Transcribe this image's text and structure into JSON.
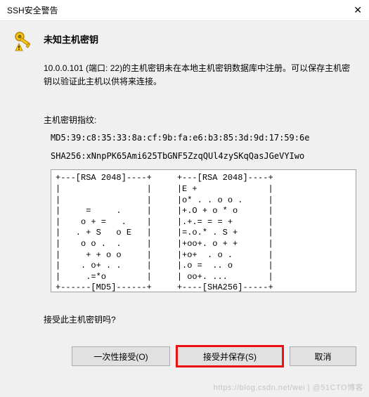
{
  "titlebar": {
    "title": "SSH安全警告"
  },
  "heading": "未知主机密钥",
  "message": "10.0.0.101 (端口: 22)的主机密钥未在本地主机密钥数据库中注册。可以保存主机密钥以验证此主机以供将来连接。",
  "fingerprint_label": "主机密钥指纹:",
  "md5_fingerprint": "MD5:39:c8:35:33:8a:cf:9b:fa:e6:b3:85:3d:9d:17:59:6e",
  "sha256_fingerprint": "SHA256:xNnpPK65Ami625TbGNF5ZzqQUl4zySKqQasJGeVYIwo",
  "ascii_art": "+---[RSA 2048]----+     +---[RSA 2048]----+\n|                 |     |E +              |\n|                 |     |o* . . o o .     |\n|     =     .     |     |+.O + o * o      |\n|    o + =   .    |     |.+.= = = +       |\n|   . + S   o E   |     |=.o.* . S +      |\n|    o o .  .     |     |+oo+. o + +      |\n|     + + o o     |     |+o+  . o .       |\n|    . o+ . .     |     |.o =  .. o       |\n|     .=*o        |     | oo+. ...        |\n+------[MD5]------+     +----[SHA256]-----+",
  "prompt": "接受此主机密钥吗?",
  "buttons": {
    "accept_once": "一次性接受(O)",
    "accept_save": "接受并保存(S)",
    "cancel": "取消"
  },
  "watermark": "https://blog.csdn.net/wei | @51CTO博客"
}
